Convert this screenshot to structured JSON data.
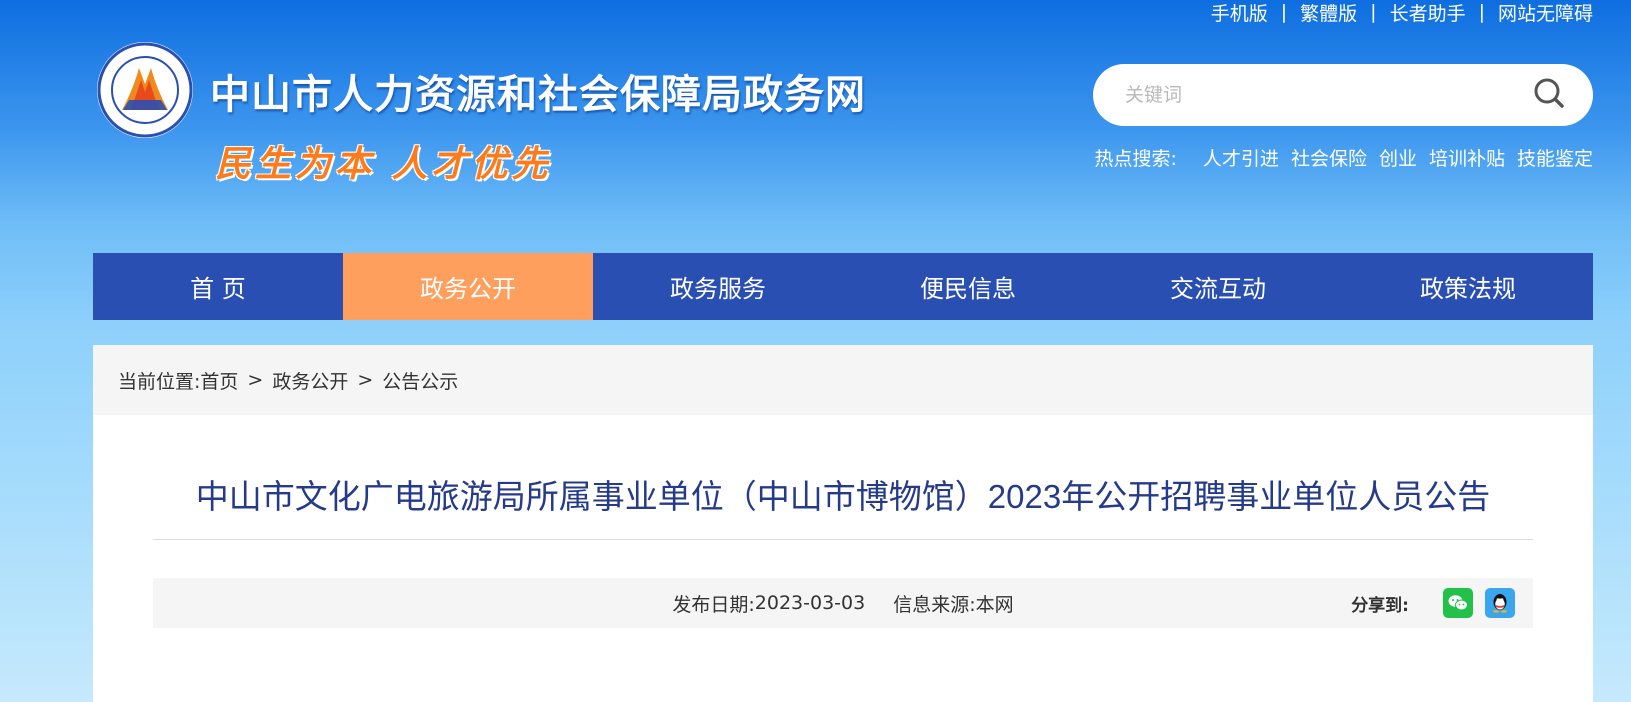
{
  "top_links": [
    "手机版",
    "繁體版",
    "长者助手",
    "网站无障碍"
  ],
  "separator": "|",
  "header": {
    "site_title": "中山市人力资源和社会保障局政务网",
    "slogan": "民生为本 人才优先"
  },
  "search": {
    "placeholder": "关键词",
    "hot_label": "热点搜索:",
    "hot_items": [
      "人才引进",
      "社会保险",
      "创业",
      "培训补贴",
      "技能鉴定"
    ]
  },
  "nav": {
    "items": [
      "首 页",
      "政务公开",
      "政务服务",
      "便民信息",
      "交流互动",
      "政策法规"
    ],
    "active_index": 1
  },
  "breadcrumb": {
    "label": "当前位置:",
    "items": [
      "首页",
      "政务公开",
      "公告公示"
    ],
    "separator": ">"
  },
  "article": {
    "title": "中山市文化广电旅游局所属事业单位（中山市博物馆）2023年公开招聘事业单位人员公告",
    "publish_label": "发布日期:",
    "publish_date": "2023-03-03",
    "source_label": "信息来源:",
    "source": "本网",
    "share_label": "分享到:"
  },
  "colors": {
    "nav_bg": "#2a4fb2",
    "nav_active": "#ff9f5e",
    "title_color": "#253b8a",
    "slogan_color": "#ff7a1a"
  }
}
